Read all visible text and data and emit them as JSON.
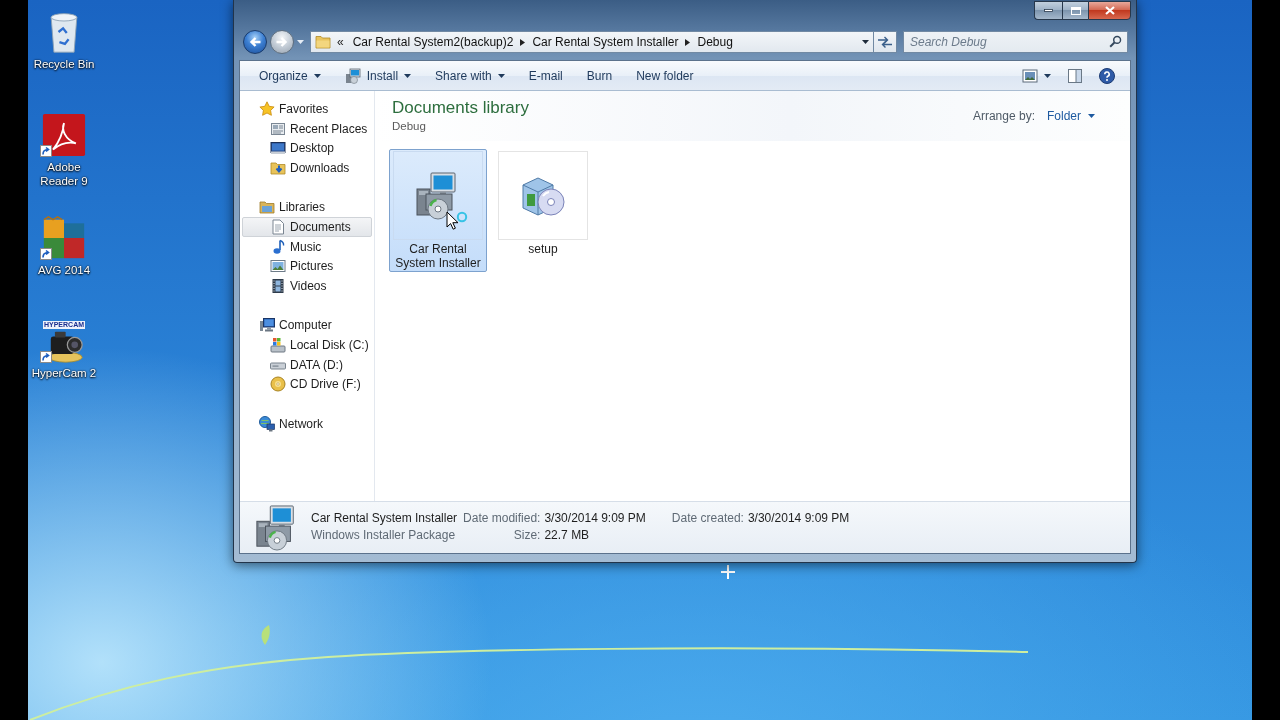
{
  "desktop": {
    "icons": [
      {
        "label": "Recycle Bin",
        "kind": "bin",
        "shortcut": false
      },
      {
        "label": "Adobe Reader 9",
        "kind": "swirl-tile",
        "shortcut": true
      },
      {
        "label": "AVG 2014",
        "kind": "squares",
        "shortcut": true
      },
      {
        "label": "HyperCam 2",
        "kind": "camera",
        "shortcut": true,
        "badge": "HYPERCAM"
      }
    ]
  },
  "address_bar": {
    "overflow": "«",
    "segments": [
      "Car Rental System2(backup)2",
      "Car Rental System Installer",
      "Debug"
    ]
  },
  "search": {
    "placeholder": "Search Debug"
  },
  "toolbar": {
    "items": [
      {
        "label": "Organize",
        "icon": false,
        "dropdown": true
      },
      {
        "label": "Install",
        "icon": true,
        "dropdown": true
      },
      {
        "label": "Share with",
        "icon": false,
        "dropdown": true
      },
      {
        "label": "E-mail",
        "icon": false,
        "dropdown": false
      },
      {
        "label": "Burn",
        "icon": false,
        "dropdown": false
      },
      {
        "label": "New folder",
        "icon": false,
        "dropdown": false
      }
    ]
  },
  "navigation": {
    "groups": [
      {
        "label": "Favorites",
        "kind": "favorites",
        "selected": false,
        "children": [
          {
            "label": "Recent Places",
            "kind": "recent",
            "selected": false
          },
          {
            "label": "Desktop",
            "kind": "desktop",
            "selected": false
          },
          {
            "label": "Downloads",
            "kind": "downloads",
            "selected": false
          }
        ]
      },
      {
        "label": "Libraries",
        "kind": "libraries",
        "selected": false,
        "children": [
          {
            "label": "Documents",
            "kind": "documents",
            "selected": true
          },
          {
            "label": "Music",
            "kind": "music",
            "selected": false
          },
          {
            "label": "Pictures",
            "kind": "pictures",
            "selected": false
          },
          {
            "label": "Videos",
            "kind": "videos",
            "selected": false
          }
        ]
      },
      {
        "label": "Computer",
        "kind": "computer",
        "selected": false,
        "children": [
          {
            "label": "Local Disk (C:)",
            "kind": "system-drive",
            "selected": false
          },
          {
            "label": "DATA (D:)",
            "kind": "drive",
            "selected": false
          },
          {
            "label": "CD Drive (F:)",
            "kind": "disc-drive",
            "selected": false
          }
        ]
      },
      {
        "label": "Network",
        "kind": "network",
        "selected": false
      }
    ]
  },
  "content": {
    "title": "Documents library",
    "subtitle": "Debug",
    "arrange_label": "Arrange by:",
    "arrange_value": "Folder",
    "items": [
      {
        "label": "Car Rental System Installer",
        "kind": "installer",
        "selected": true
      },
      {
        "label": "setup",
        "kind": "setup",
        "selected": false
      }
    ]
  },
  "details": {
    "kind": "installer",
    "name": "Car Rental System Installer",
    "type": "Windows Installer Package",
    "fields": [
      {
        "label": "Date modified:",
        "value": "3/30/2014 9:09 PM"
      },
      {
        "label": "Size:",
        "value": "22.7 MB"
      },
      {
        "label": "Date created:",
        "value": "3/30/2014 9:09 PM"
      }
    ]
  }
}
